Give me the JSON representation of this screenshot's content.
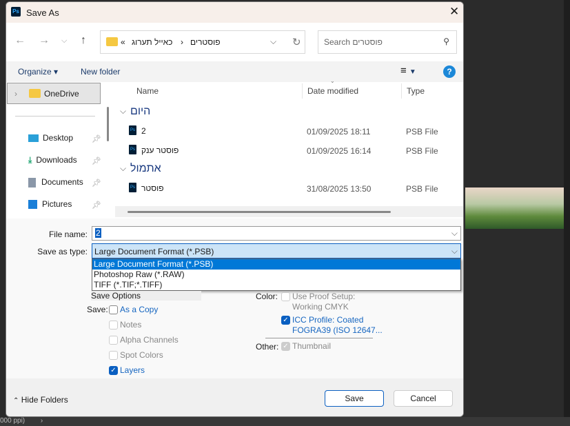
{
  "title": "Save As",
  "address": {
    "overflow": "«",
    "path": [
      "כאייל תערוג",
      "פוסטרים"
    ],
    "sep": "›"
  },
  "search": {
    "placeholder": "Search פוסטרים"
  },
  "toolbar": {
    "organize": "Organize",
    "new_folder": "New folder"
  },
  "nav": {
    "onedrive": "OneDrive",
    "items": [
      "Desktop",
      "Downloads",
      "Documents",
      "Pictures"
    ]
  },
  "columns": {
    "name": "Name",
    "date": "Date modified",
    "type": "Type"
  },
  "groups": [
    {
      "label": "היום",
      "files": [
        {
          "name": "2",
          "date": "01/09/2025 18:11",
          "type": "PSB File"
        },
        {
          "name": "פוסטר ענק",
          "date": "01/09/2025 16:14",
          "type": "PSB File"
        }
      ]
    },
    {
      "label": "אתמול",
      "files": [
        {
          "name": "פוסטר",
          "date": "31/08/2025 13:50",
          "type": "PSB File"
        }
      ]
    }
  ],
  "form": {
    "file_name_label": "File name:",
    "file_name": "2",
    "type_label": "Save as type:",
    "type_value": "Large Document Format (*.PSB)",
    "type_options": [
      "Large Document Format (*.PSB)",
      "Photoshop Raw (*.RAW)",
      "TIFF (*.TIF;*.TIFF)"
    ]
  },
  "options": {
    "heading": "Save Options",
    "save_label": "Save:",
    "as_copy": "As a Copy",
    "notes": "Notes",
    "alpha": "Alpha Channels",
    "spot": "Spot Colors",
    "layers": "Layers",
    "color_label": "Color:",
    "proof1": "Use Proof Setup:",
    "proof2": "Working CMYK",
    "icc1": "ICC Profile:  Coated",
    "icc2": "FOGRA39 (ISO 12647...",
    "other_label": "Other:",
    "thumbnail": "Thumbnail"
  },
  "footer": {
    "hide_folders": "Hide Folders",
    "save": "Save",
    "cancel": "Cancel"
  },
  "status": "000 ppi)"
}
